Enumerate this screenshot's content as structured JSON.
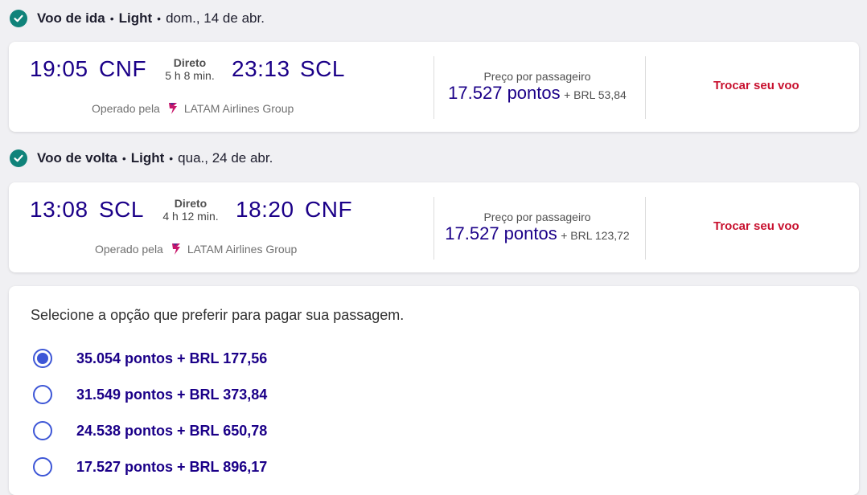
{
  "outbound": {
    "heading": "Voo de ida",
    "fare": "Light",
    "date": "dom., 14 de abr.",
    "dep_time": "19:05",
    "dep_airport": "CNF",
    "stop_label": "Direto",
    "duration": "5 h 8 min.",
    "arr_time": "23:13",
    "arr_airport": "SCL",
    "operated_label": "Operado pela",
    "airline": "LATAM Airlines Group",
    "price_label": "Preço por passageiro",
    "points": "17.527 pontos",
    "brl": "+ BRL 53,84",
    "change_label": "Trocar seu voo"
  },
  "return": {
    "heading": "Voo de volta",
    "fare": "Light",
    "date": "qua., 24 de abr.",
    "dep_time": "13:08",
    "dep_airport": "SCL",
    "stop_label": "Direto",
    "duration": "4 h 12 min.",
    "arr_time": "18:20",
    "arr_airport": "CNF",
    "operated_label": "Operado pela",
    "airline": "LATAM Airlines Group",
    "price_label": "Preço por passageiro",
    "points": "17.527 pontos",
    "brl": "+ BRL 123,72",
    "change_label": "Trocar seu voo"
  },
  "payment": {
    "title": "Selecione a opção que preferir para pagar sua passagem.",
    "options": [
      {
        "label": "35.054 pontos + BRL 177,56",
        "selected": true
      },
      {
        "label": "31.549 pontos + BRL 373,84",
        "selected": false
      },
      {
        "label": "24.538 pontos + BRL 650,78",
        "selected": false
      },
      {
        "label": "17.527 pontos + BRL 896,17",
        "selected": false
      }
    ]
  },
  "colors": {
    "brand_indigo": "#1b0088",
    "check_teal": "#10837a",
    "change_red": "#c8102e",
    "radio_blue": "#3d56d6"
  }
}
